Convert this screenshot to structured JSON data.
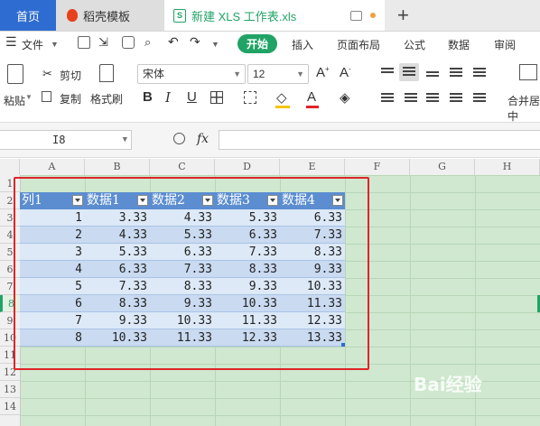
{
  "tabs": {
    "home": "首页",
    "template": "稻壳模板",
    "document": "新建 XLS 工作表.xls"
  },
  "menu": {
    "file": "文件",
    "start": "开始",
    "insert": "插入",
    "layout": "页面布局",
    "formula": "公式",
    "data": "数据",
    "review": "审阅"
  },
  "ribbon": {
    "paste": "粘贴",
    "cut": "剪切",
    "copy": "复制",
    "format_painter": "格式刷",
    "font_name": "宋体",
    "font_size": "12",
    "merge": "合并居中"
  },
  "formula_bar": {
    "cell_ref": "I8",
    "fx": "fx"
  },
  "columns": [
    "A",
    "B",
    "C",
    "D",
    "E",
    "F",
    "G",
    "H"
  ],
  "rows": [
    "1",
    "2",
    "3",
    "4",
    "5",
    "6",
    "7",
    "8",
    "9",
    "10",
    "11",
    "12",
    "13",
    "14"
  ],
  "table": {
    "headers": [
      "列1",
      "数据1",
      "数据2",
      "数据3",
      "数据4"
    ],
    "data": [
      [
        "1",
        "3.33",
        "4.33",
        "5.33",
        "6.33"
      ],
      [
        "2",
        "4.33",
        "5.33",
        "6.33",
        "7.33"
      ],
      [
        "3",
        "5.33",
        "6.33",
        "7.33",
        "8.33"
      ],
      [
        "4",
        "6.33",
        "7.33",
        "8.33",
        "9.33"
      ],
      [
        "5",
        "7.33",
        "8.33",
        "9.33",
        "10.33"
      ],
      [
        "6",
        "8.33",
        "9.33",
        "10.33",
        "11.33"
      ],
      [
        "7",
        "9.33",
        "10.33",
        "11.33",
        "12.33"
      ],
      [
        "8",
        "10.33",
        "11.33",
        "12.33",
        "13.33"
      ]
    ]
  },
  "colors": {
    "accent_green": "#21a366",
    "table_header": "#5b8dd0",
    "highlight_border": "#e0242a",
    "sheet_bg": "#cfe8cf"
  },
  "watermark": "Bai经验"
}
